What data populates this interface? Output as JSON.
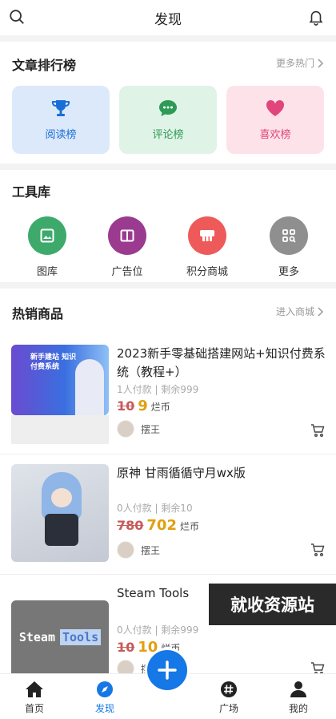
{
  "header": {
    "title": "发现",
    "left_icon": "search-icon",
    "right_icon": "bell-icon"
  },
  "ranking": {
    "title": "文章排行榜",
    "more": "更多热门",
    "items": [
      {
        "label": "阅读榜",
        "icon": "trophy-icon",
        "bg": "#dce9fb",
        "fg": "#1a6fd6"
      },
      {
        "label": "评论榜",
        "icon": "chat-bubble-icon",
        "bg": "#dff3e6",
        "fg": "#2d9a55"
      },
      {
        "label": "喜欢榜",
        "icon": "heart-icon",
        "bg": "#fde2ea",
        "fg": "#e0457b"
      }
    ]
  },
  "tools": {
    "title": "工具库",
    "items": [
      {
        "label": "图库",
        "icon": "image-icon",
        "color": "#3daa6b"
      },
      {
        "label": "广告位",
        "icon": "book-icon",
        "color": "#9b3b8f"
      },
      {
        "label": "积分商城",
        "icon": "store-icon",
        "color": "#ee5a5a"
      },
      {
        "label": "更多",
        "icon": "search-grid-icon",
        "color": "#8f8f8f"
      }
    ]
  },
  "hot": {
    "title": "热销商品",
    "more": "进入商城",
    "unit": "烂币",
    "products": [
      {
        "name": "2023新手零基础搭建网站+知识付费系统（教程+）",
        "stats": "1人付款 | 剩余999",
        "old_price": "10",
        "price": "9",
        "seller": "摆王",
        "thumb_text": "新手建站 知识付费系统"
      },
      {
        "name": "原神 甘雨循循守月wx版",
        "stats": "0人付款 | 剩余10",
        "old_price": "780",
        "price": "702",
        "seller": "摆王"
      },
      {
        "name": "Steam Tools",
        "stats": "0人付款 | 剩余999",
        "old_price": "10",
        "price": "10",
        "seller": "摆王",
        "thumb_text_a": "Steam",
        "thumb_text_b": "Tools"
      }
    ]
  },
  "watermark": "就收资源站",
  "tabbar": {
    "items": [
      {
        "label": "首页",
        "icon": "home-icon"
      },
      {
        "label": "发现",
        "icon": "compass-icon",
        "active": true
      },
      {
        "label": "广场",
        "icon": "hashtag-icon"
      },
      {
        "label": "我的",
        "icon": "user-icon"
      }
    ],
    "fab_icon": "plus-icon"
  }
}
